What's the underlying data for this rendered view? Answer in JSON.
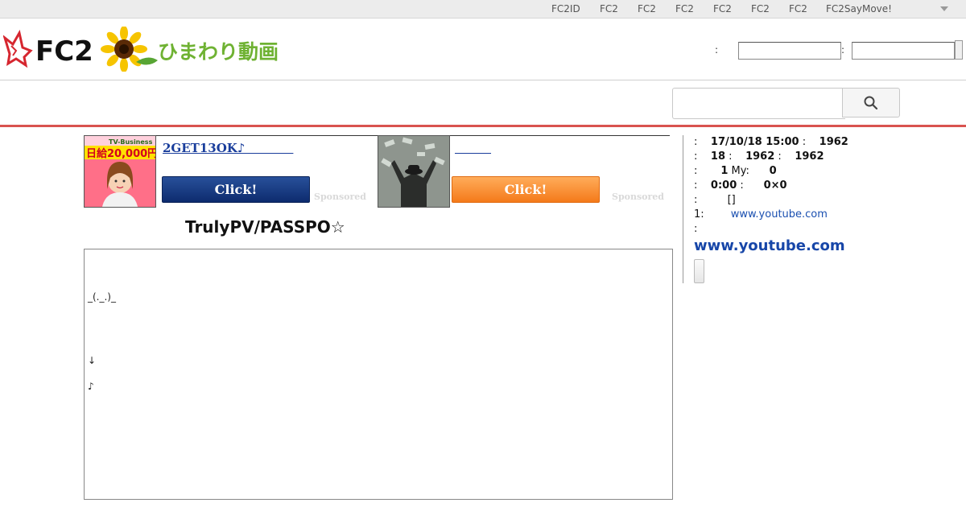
{
  "colors": {
    "accent_red": "#d9534f",
    "link_blue": "#1746a8",
    "ad_blue": "#0d2b6e",
    "ad_orange": "#f47a1a"
  },
  "topnav": {
    "items": [
      "FC2ID",
      "FC2",
      "FC2",
      "FC2",
      "FC2",
      "FC2",
      "FC2",
      "FC2SayMove!"
    ],
    "more_icon": "chevron-down-icon"
  },
  "logo": {
    "brand": "FC2",
    "product": "ひまわり動画"
  },
  "login": {
    "colon1": ":",
    "colon2": ":",
    "user_value": "",
    "pass_value": ""
  },
  "search": {
    "value": "",
    "icon": "search-icon"
  },
  "ads": [
    {
      "image_badge": "TV-Business",
      "image_text": "日給20,000円",
      "title": "2GET13OK♪　　　　",
      "button": "Click!",
      "sponsored": "Sponsored"
    },
    {
      "title": "　　　",
      "button": "Click!",
      "sponsored": "Sponsored"
    }
  ],
  "video": {
    "title": "TrulyPV/PASSPO☆",
    "description_lines": [
      "_(._.)_",
      "↓",
      "♪"
    ]
  },
  "sidebar": {
    "rows": [
      {
        "c1": ":",
        "v1": "17/10/18 15:00",
        "c2": ":",
        "v2": "1962"
      },
      {
        "c1": ":",
        "v1": "18",
        "c2": ":",
        "v2": "1962",
        "c3": ":",
        "v3": "1962"
      },
      {
        "c1": ":",
        "v1": "1",
        "l2": "My:",
        "v2": "0"
      },
      {
        "c1": ":",
        "v1": "0:00",
        "c2": ":",
        "v2": "0×0"
      },
      {
        "c1": ":",
        "v1": "[]"
      }
    ],
    "source_label": "1:",
    "source_link": "www.youtube.com",
    "source_colon": ":",
    "big_link": "www.youtube.com"
  }
}
